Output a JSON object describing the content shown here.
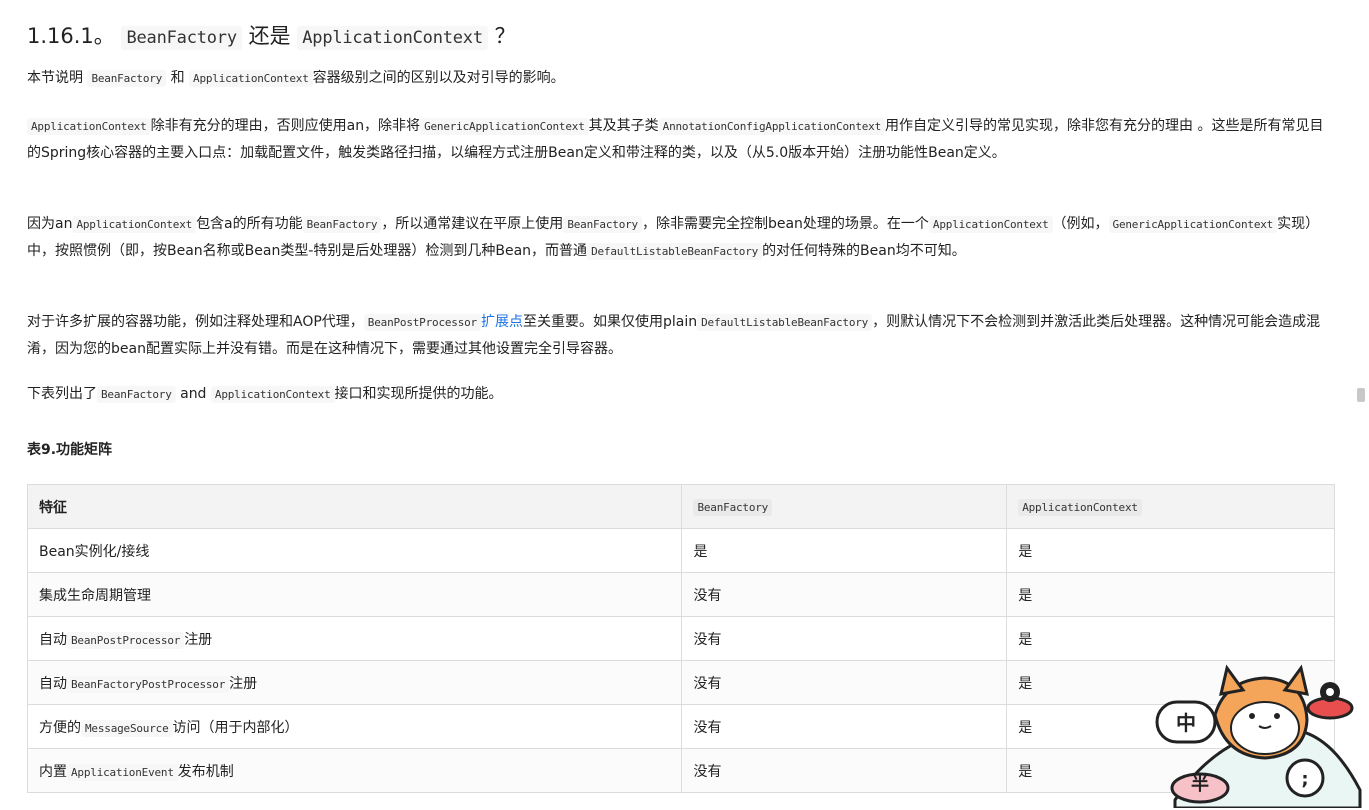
{
  "heading": {
    "number": "1.16.1。",
    "code1": "BeanFactory",
    "mid": "还是",
    "code2": "ApplicationContext",
    "end": "？"
  },
  "p1": {
    "t1": "本节说明",
    "c1": "BeanFactory",
    "t2": "和",
    "c2": "ApplicationContext",
    "t3": "容器级别之间的区别以及对引导的影响。"
  },
  "p2": {
    "c1": "ApplicationContext",
    "t1": "除非有充分的理由，否则应使用an，除非将",
    "c2": "GenericApplicationContext",
    "t2": "其及其子类",
    "c3": "AnnotationConfigApplicationContext",
    "t3": "用作自定义引导的常见实现，除非您有充分的理由 。这些是所有常见目的Spring核心容器的主要入口点：加载配置文件，触发类路径扫描，以编程方式注册Bean定义和带注释的类，以及（从5.0版本开始）注册功能性Bean定义。"
  },
  "p3": {
    "t1": "因为an",
    "c1": "ApplicationContext",
    "t2": "包含a的所有功能",
    "c2": "BeanFactory",
    "t3": "，所以通常建议在平原上使用",
    "c3": "BeanFactory",
    "t4": "，除非需要完全控制bean处理的场景。在一个",
    "c4": "ApplicationContext",
    "t5": "（例如，",
    "c5": "GenericApplicationContext",
    "t6": "实现）中，按照惯例（即，按Bean名称或Bean类型-特别是后处理器）检测到几种Bean，而普通",
    "c6": "DefaultListableBeanFactory",
    "t7": "的对任何特殊的Bean均不可知。"
  },
  "p4": {
    "t1": "对于许多扩展的容器功能，例如注释处理和AOP代理，",
    "c1": "BeanPostProcessor",
    "link": "扩展点",
    "t2": "至关重要。如果仅使用plain",
    "c2": "DefaultListableBeanFactory",
    "t3": "，则默认情况下不会检测到并激活此类后处理器。这种情况可能会造成混淆，因为您的bean配置实际上并没有错。而是在这种情况下，需要通过其他设置完全引导容器。"
  },
  "p5": {
    "t1": "下表列出了",
    "c1": "BeanFactory",
    "t2": "and",
    "c2": "ApplicationContext",
    "t3": "接口和实现所提供的功能。"
  },
  "table_title": "表9.功能矩阵",
  "table": {
    "headers": [
      "特征",
      "BeanFactory",
      "ApplicationContext"
    ],
    "rows": [
      {
        "pre": "Bean实例化/接线",
        "code": "",
        "post": "",
        "bf": "是",
        "ac": "是"
      },
      {
        "pre": "集成生命周期管理",
        "code": "",
        "post": "",
        "bf": "没有",
        "ac": "是"
      },
      {
        "pre": "自动",
        "code": "BeanPostProcessor",
        "post": "注册",
        "bf": "没有",
        "ac": "是"
      },
      {
        "pre": "自动",
        "code": "BeanFactoryPostProcessor",
        "post": "注册",
        "bf": "没有",
        "ac": "是"
      },
      {
        "pre": "方便的",
        "code": "MessageSource",
        "post": "访问（用于内部化）",
        "bf": "没有",
        "ac": "是"
      },
      {
        "pre": "内置",
        "code": "ApplicationEvent",
        "post": "发布机制",
        "bf": "没有",
        "ac": "是"
      }
    ]
  },
  "mascot": {
    "label1": "中",
    "label2": "半"
  },
  "colors": {
    "link": "#1a73e8",
    "header_bg": "#f3f3f3",
    "code_bg": "#f7f7f8"
  }
}
